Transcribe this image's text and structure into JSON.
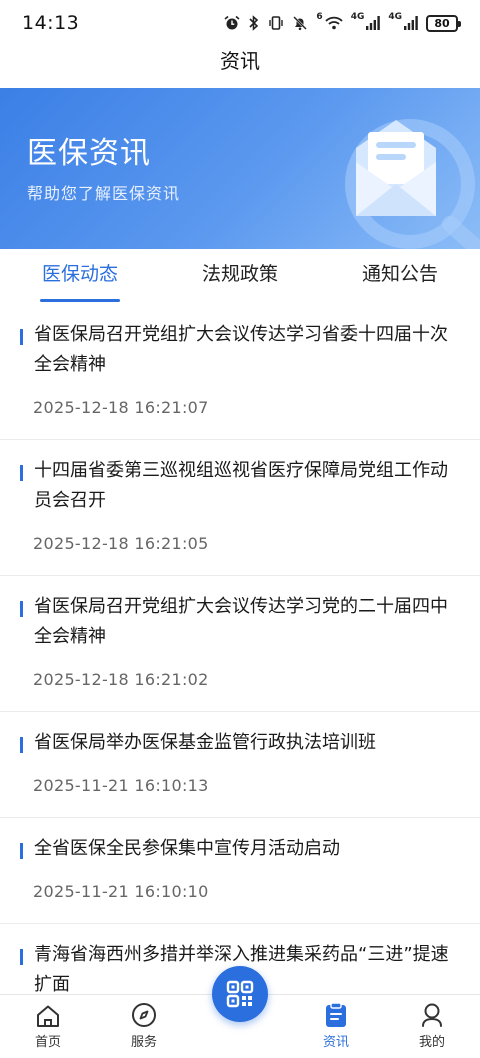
{
  "status_bar": {
    "time": "14:13",
    "battery": "80",
    "signal_label_1": "4G",
    "signal_label_2": "4G",
    "wifi_label": "6"
  },
  "header": {
    "title": "资讯"
  },
  "banner": {
    "title": "医保资讯",
    "subtitle": "帮助您了解医保资讯"
  },
  "tabs": [
    {
      "label": "医保动态",
      "active": true
    },
    {
      "label": "法规政策",
      "active": false
    },
    {
      "label": "通知公告",
      "active": false
    }
  ],
  "news": [
    {
      "title": "省医保局召开党组扩大会议传达学习省委十四届十次全会精神",
      "date": "2025-12-18 16:21:07"
    },
    {
      "title": "十四届省委第三巡视组巡视省医疗保障局党组工作动员会召开",
      "date": "2025-12-18 16:21:05"
    },
    {
      "title": "省医保局召开党组扩大会议传达学习党的二十届四中全会精神",
      "date": "2025-12-18 16:21:02"
    },
    {
      "title": "省医保局举办医保基金监管行政执法培训班",
      "date": "2025-11-21 16:10:13"
    },
    {
      "title": "全省医保全民参保集中宣传月活动启动",
      "date": "2025-11-21 16:10:10"
    },
    {
      "title": "青海省海西州多措并举深入推进集采药品“三进”提速扩面",
      "date": ""
    }
  ],
  "bottom_nav": [
    {
      "label": "首页",
      "icon": "home-icon"
    },
    {
      "label": "服务",
      "icon": "compass-icon"
    },
    {
      "label": "",
      "icon": "qr-scan-icon"
    },
    {
      "label": "资讯",
      "icon": "news-icon",
      "active": true
    },
    {
      "label": "我的",
      "icon": "profile-icon"
    }
  ],
  "colors": {
    "accent": "#2b6fde",
    "banner_start": "#3b7fe6",
    "banner_end": "#8cbdf7"
  }
}
